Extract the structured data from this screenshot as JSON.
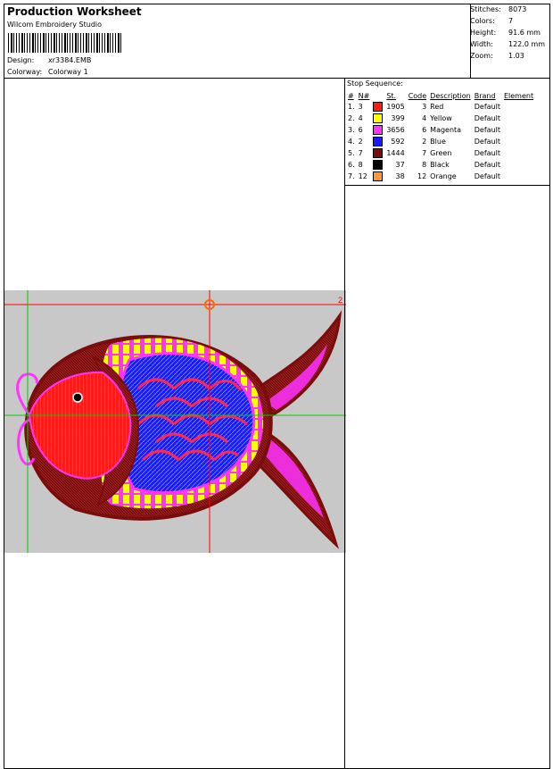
{
  "header": {
    "title": "Production Worksheet",
    "software": "Wilcom Embroidery Studio",
    "design_label": "Design:",
    "design_value": "xr3384.EMB",
    "colorway_label": "Colorway:",
    "colorway_value": "Colorway 1"
  },
  "stats": [
    {
      "label": "Stitches:",
      "value": "8073"
    },
    {
      "label": "Colors:",
      "value": "7"
    },
    {
      "label": "Height:",
      "value": "91.6 mm"
    },
    {
      "label": "Width:",
      "value": "122.0 mm"
    },
    {
      "label": "Zoom:",
      "value": "1.03"
    }
  ],
  "stop_sequence": {
    "title": "Stop Sequence:",
    "headers": {
      "index": "#",
      "n": "N#",
      "st": "St.",
      "code": "Code",
      "description": "Description",
      "brand": "Brand",
      "element": "Element"
    },
    "rows": [
      {
        "index": "1.",
        "n": "3",
        "color": "#ff1a1a",
        "st": "1905",
        "code": "3",
        "description": "Red",
        "brand": "Default"
      },
      {
        "index": "2.",
        "n": "4",
        "color": "#ffff00",
        "st": "399",
        "code": "4",
        "description": "Yellow",
        "brand": "Default"
      },
      {
        "index": "3.",
        "n": "6",
        "color": "#ff33ff",
        "st": "3656",
        "code": "6",
        "description": "Magenta",
        "brand": "Default"
      },
      {
        "index": "4.",
        "n": "2",
        "color": "#1a1aff",
        "st": "592",
        "code": "2",
        "description": "Blue",
        "brand": "Default"
      },
      {
        "index": "5.",
        "n": "7",
        "color": "#7a0c0c",
        "st": "1444",
        "code": "7",
        "description": "Green",
        "brand": "Default"
      },
      {
        "index": "6.",
        "n": "8",
        "color": "#000000",
        "st": "37",
        "code": "8",
        "description": "Black",
        "brand": "Default"
      },
      {
        "index": "7.",
        "n": "12",
        "color": "#ff9933",
        "st": "38",
        "code": "12",
        "description": "Orange",
        "brand": "Default"
      }
    ]
  },
  "canvas": {
    "marker_label": "2",
    "background_color": "#c8c8c8",
    "guide_colors": {
      "horizontal": "#ff0000",
      "vertical": "#00cc00"
    }
  }
}
